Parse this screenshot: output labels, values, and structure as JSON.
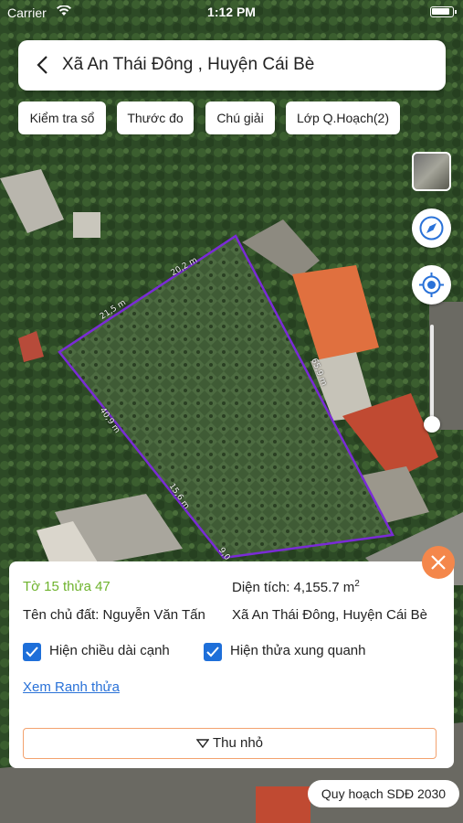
{
  "status": {
    "carrier": "Carrier",
    "time": "1:12 PM"
  },
  "header": {
    "title": "Xã An Thái Đông , Huyện Cái Bè"
  },
  "toolbar": {
    "check_book": "Kiểm tra sổ",
    "ruler": "Thước đo",
    "legend": "Chú giải",
    "planning_layer": "Lớp Q.Hoạch(2)"
  },
  "map": {
    "edges": [
      "20,2 m",
      "21,5 m",
      "65,9 m",
      "40,9 m",
      "15,6 m",
      "9,0"
    ],
    "parcel_color": "#7a2bd6"
  },
  "panel": {
    "parcel": "Tờ 15 thửa 47",
    "area_label": "Diện tích: 4,155.7 m",
    "area_unit_sup": "2",
    "owner": "Tên chủ đất: Nguyễn Văn Tấn",
    "location": "Xã An Thái Đông, Huyện Cái Bè",
    "show_edges": "Hiện chiều dài cạnh",
    "show_neighbors": "Hiện thửa xung quanh",
    "view_boundary": "Xem Ranh thửa",
    "collapse": "Thu nhỏ"
  },
  "footer_badge": "Quy hoạch SDĐ 2030",
  "colors": {
    "accent": "#f4874b",
    "checkbox": "#1e6fd9",
    "link": "#2a72d8",
    "green": "#6fb32e"
  }
}
